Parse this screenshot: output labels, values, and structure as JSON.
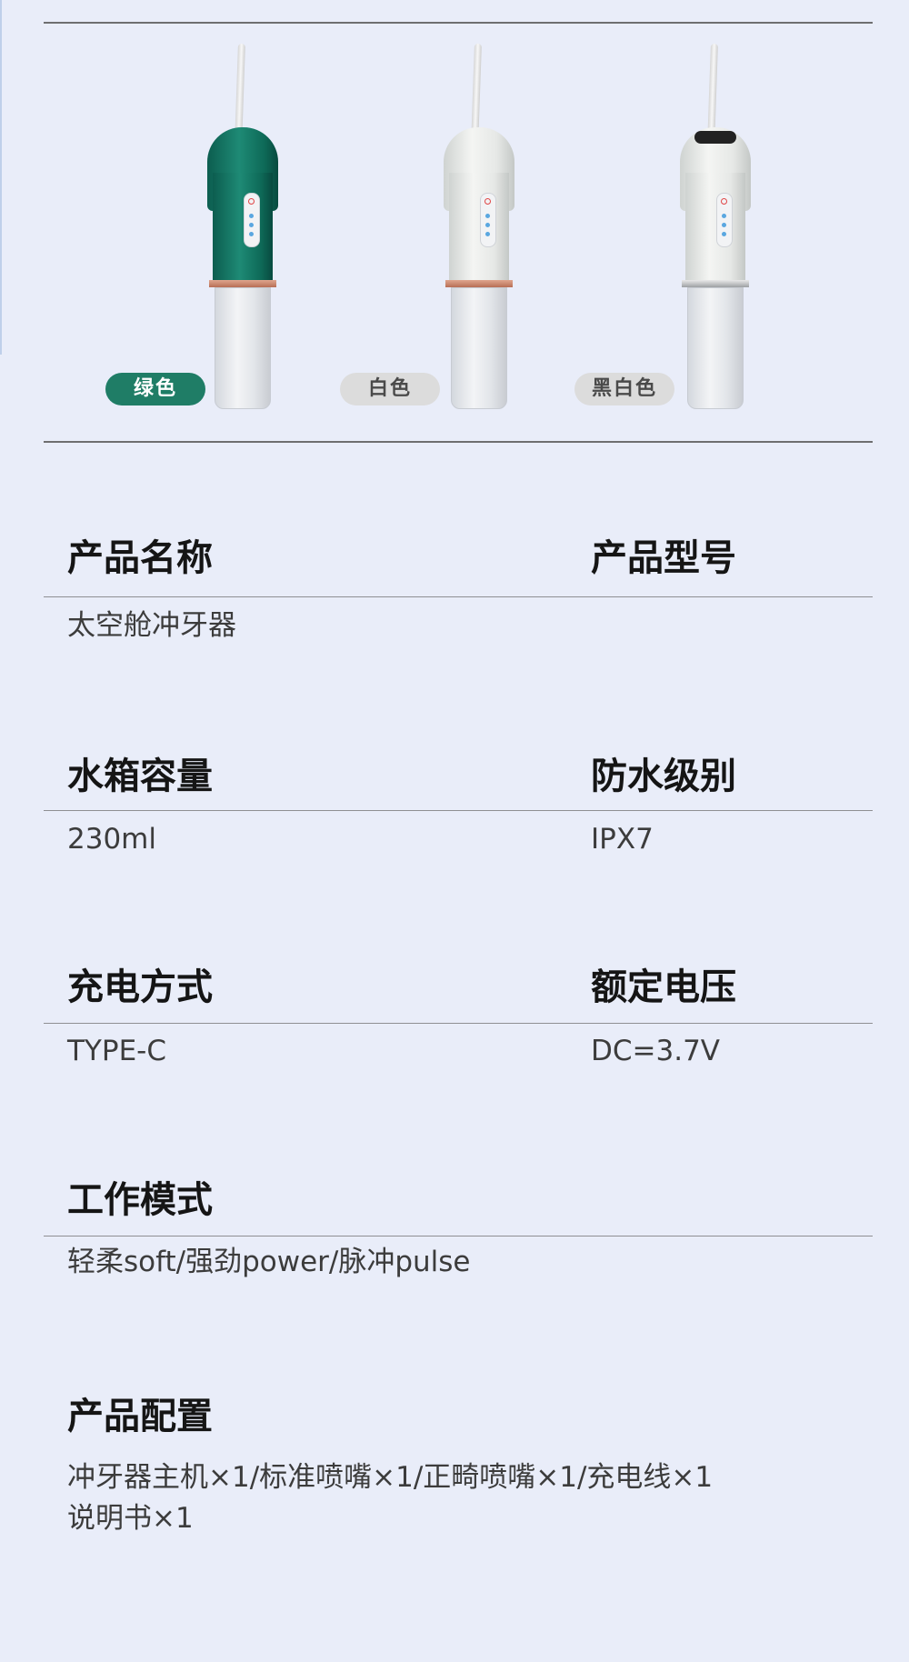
{
  "colors": {
    "background": "#e9edf9",
    "green_pill": "#1f7d66",
    "gray_pill": "#dcdcdc",
    "rose_gold_ring": "#c98063"
  },
  "variants": [
    {
      "label": "绿色",
      "icon": "water-flosser-green"
    },
    {
      "label": "白色",
      "icon": "water-flosser-white"
    },
    {
      "label": "黑白色",
      "icon": "water-flosser-black-white"
    }
  ],
  "specs": {
    "product_name": {
      "label": "产品名称",
      "value": "太空舱冲牙器"
    },
    "model": {
      "label": "产品型号",
      "value": ""
    },
    "tank_capacity": {
      "label": "水箱容量",
      "value": "230ml"
    },
    "waterproof": {
      "label": "防水级别",
      "value": "IPX7"
    },
    "charging": {
      "label": "充电方式",
      "value": "TYPE-C"
    },
    "voltage": {
      "label": "额定电压",
      "value": "DC=3.7V"
    },
    "modes": {
      "label": "工作模式",
      "value": "轻柔soft/强劲power/脉冲pulse"
    },
    "package": {
      "label": "产品配置",
      "value_line1": "冲牙器主机×1/标准喷嘴×1/正畸喷嘴×1/充电线×1",
      "value_line2": "说明书×1"
    }
  }
}
